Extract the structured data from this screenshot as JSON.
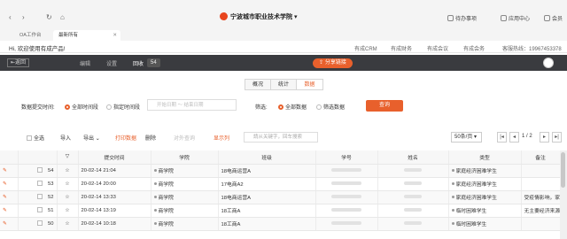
{
  "browser": {
    "nav_icons": [
      "back-arrow-icon",
      "forward-arrow-icon",
      "reload-icon",
      "home-icon"
    ],
    "org_title": "宁波城市职业技术学院",
    "right": {
      "todo": "待办事项",
      "app_center": "应用中心",
      "user": "会员"
    }
  },
  "tabs": [
    {
      "label": "OA工作台"
    },
    {
      "label": "最新所有"
    }
  ],
  "welcome": {
    "message": "Hi, 欢迎使用有成产品!",
    "links": [
      "有成CRM",
      "有成财务",
      "有成会议",
      "有成会务"
    ],
    "hotline": "客服热线：19967453378"
  },
  "toolbar": {
    "back": "返回",
    "nav": [
      "编辑",
      "设置",
      "回收"
    ],
    "count": "54",
    "share": "分享链接"
  },
  "segments": [
    "概况",
    "统计",
    "数据"
  ],
  "filters": {
    "time_label": "数据提交时间:",
    "opt_all_time": "全部时间段",
    "opt_custom": "指定时间段",
    "date_placeholder": "开始日期 ～ 结束日期",
    "screen_label": "筛选:",
    "opt_all_data": "全部数据",
    "opt_filter": "筛选数据",
    "query": "查询"
  },
  "table_toolbar": {
    "select_all": "全选",
    "import": "导入",
    "export": "导出",
    "print": "打印数据",
    "delete": "删除",
    "compare": "对外查询",
    "show_cols": "显示列",
    "search_placeholder": "請从关键字，回车搜索",
    "per_page": "50条/页",
    "page_info": "1 / 2"
  },
  "columns": [
    "",
    "",
    "",
    "提交时间",
    "学院",
    "班级",
    "学号",
    "姓名",
    "类型",
    "备注"
  ],
  "rows": [
    {
      "no": "54",
      "time": "20-02-14 21:04",
      "college": "商学院",
      "class": "18电商运营A",
      "type": "家庭经济困难学生",
      "note": ""
    },
    {
      "no": "53",
      "time": "20-02-14 20:00",
      "college": "商学院",
      "class": "17电商A2",
      "type": "家庭经济困难学生",
      "note": ""
    },
    {
      "no": "52",
      "time": "20-02-14 13:33",
      "college": "商学院",
      "class": "18电商运营A",
      "type": "家庭经济困难学生",
      "note": "受疫情影响，家中…"
    },
    {
      "no": "51",
      "time": "20-02-14 13:19",
      "college": "商学院",
      "class": "18工商A",
      "type": "临时困难学生",
      "note": "无主要经济来源受…"
    },
    {
      "no": "50",
      "time": "20-02-14 10:18",
      "college": "商学院",
      "class": "18工商A",
      "type": "临时困难学生",
      "note": ""
    }
  ],
  "colors": {
    "accent": "#e8602c",
    "dark_bar": "#3a3b3f"
  }
}
